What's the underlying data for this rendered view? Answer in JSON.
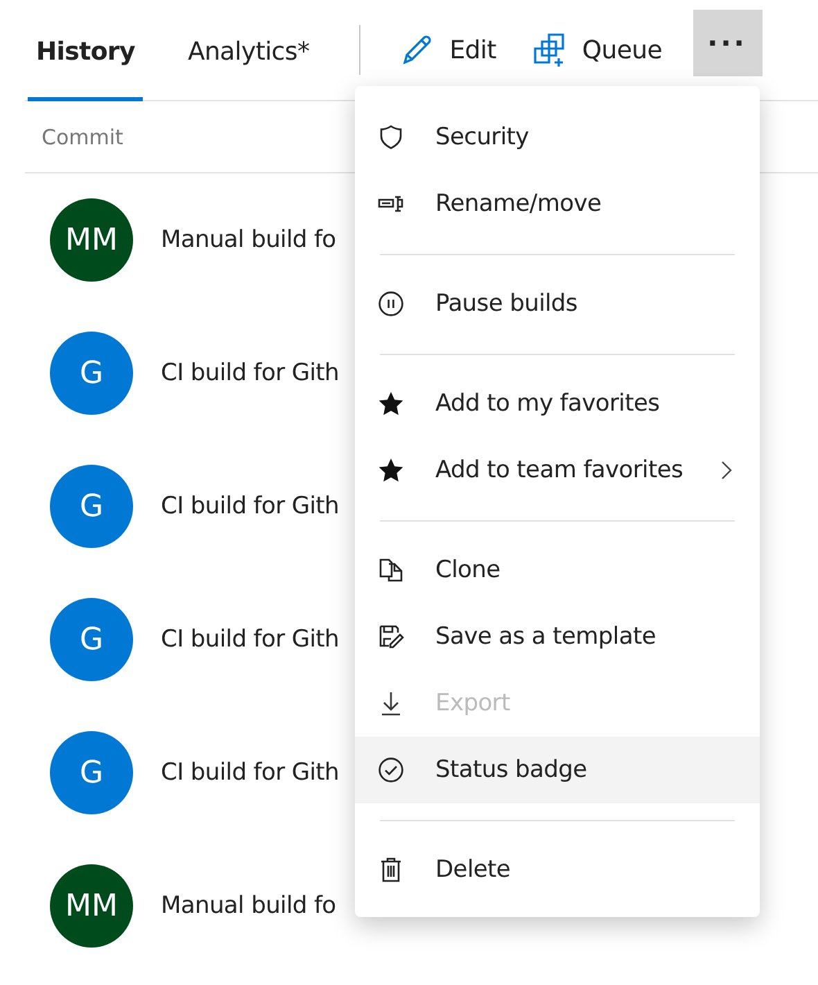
{
  "tabs": [
    {
      "label": "History",
      "selected": true
    },
    {
      "label": "Analytics*",
      "selected": false
    }
  ],
  "toolbar": {
    "buttons": [
      {
        "label": "Edit"
      },
      {
        "label": "Queue"
      }
    ],
    "more": {
      "label": "···",
      "expanded": true
    }
  },
  "table": {
    "columns": [
      "Commit"
    ],
    "rows": [
      {
        "initials": "MM",
        "color": "#004b1c",
        "title": "Manual build fo"
      },
      {
        "initials": "G",
        "color": "#0078d4",
        "title": "CI build for Gith"
      },
      {
        "initials": "G",
        "color": "#0078d4",
        "title": "CI build for Gith"
      },
      {
        "initials": "G",
        "color": "#0078d4",
        "title": "CI build for Gith"
      },
      {
        "initials": "G",
        "color": "#0078d4",
        "title": "CI build for Gith"
      },
      {
        "initials": "MM",
        "color": "#004b1c",
        "title": "Manual build fo"
      }
    ]
  },
  "menu": {
    "items": [
      {
        "kind": "item",
        "label": "Security",
        "disabled": false,
        "highlighted": false,
        "submenu": false
      },
      {
        "kind": "item",
        "label": "Rename/move",
        "disabled": false,
        "highlighted": false,
        "submenu": false
      },
      {
        "kind": "divider"
      },
      {
        "kind": "item",
        "label": "Pause builds",
        "disabled": false,
        "highlighted": false,
        "submenu": false
      },
      {
        "kind": "divider"
      },
      {
        "kind": "item",
        "label": "Add to my favorites",
        "disabled": false,
        "highlighted": false,
        "submenu": false
      },
      {
        "kind": "item",
        "label": "Add to team favorites",
        "disabled": false,
        "highlighted": false,
        "submenu": true
      },
      {
        "kind": "divider"
      },
      {
        "kind": "item",
        "label": "Clone",
        "disabled": false,
        "highlighted": false,
        "submenu": false
      },
      {
        "kind": "item",
        "label": "Save as a template",
        "disabled": false,
        "highlighted": false,
        "submenu": false
      },
      {
        "kind": "item",
        "label": "Export",
        "disabled": true,
        "highlighted": false,
        "submenu": false
      },
      {
        "kind": "item",
        "label": "Status badge",
        "disabled": false,
        "highlighted": true,
        "submenu": false
      },
      {
        "kind": "divider"
      },
      {
        "kind": "item",
        "label": "Delete",
        "disabled": false,
        "highlighted": false,
        "submenu": false
      }
    ]
  }
}
